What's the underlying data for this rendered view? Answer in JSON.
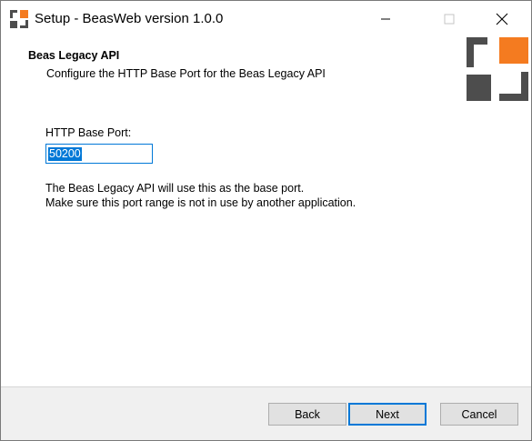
{
  "window": {
    "title": "Setup - BeasWeb version 1.0.0",
    "icon": "beasweb-setup-icon",
    "controls": [
      "minimize-icon",
      "maximize-icon",
      "close-icon"
    ]
  },
  "header": {
    "title": "Beas Legacy API",
    "subtitle": "Configure the HTTP Base Port for the Beas Legacy API",
    "logo": "beas-logo"
  },
  "form": {
    "port_label": "HTTP Base Port:",
    "port_value": "50200",
    "info_line1": "The Beas Legacy API will use this as the base port.",
    "info_line2": "Make sure this port range is not in use by another application."
  },
  "footer": {
    "back_label": "Back",
    "next_label": "Next",
    "cancel_label": "Cancel"
  },
  "colors": {
    "accent": "#0078d7",
    "logo_dark": "#4d4d4d",
    "logo_orange": "#f47b20"
  }
}
